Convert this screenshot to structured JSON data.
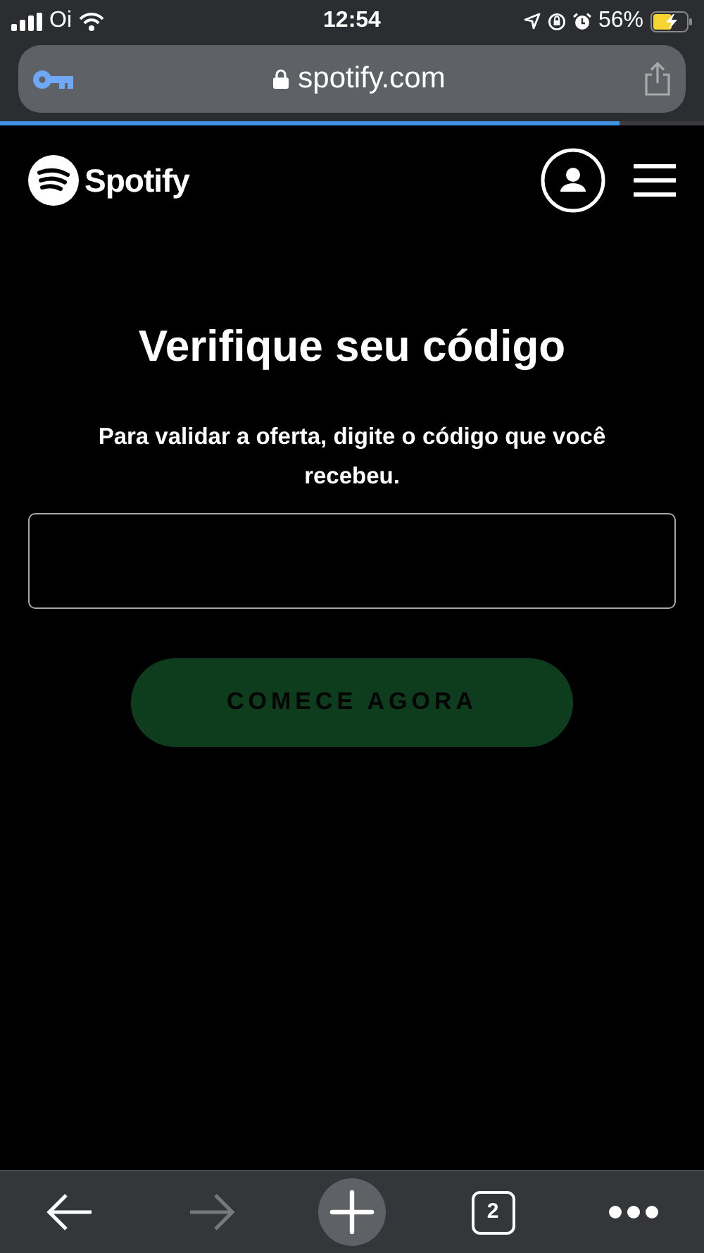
{
  "status_bar": {
    "carrier": "Oi",
    "time": "12:54",
    "battery": "56%"
  },
  "address_bar": {
    "url": "spotify.com",
    "load_progress": {
      "level": 0.88
    }
  },
  "header": {
    "logo_text": "Spotify"
  },
  "title": "Verifique seu código",
  "description": "Para validar a oferta, digite o código que você recebeu.",
  "submit_button": {
    "label": "COMECE AGORA",
    "disabled": true
  },
  "toolbar": {
    "buttons": [
      {
        "kind": "back",
        "disabled": false
      },
      {
        "kind": "forward",
        "disabled": true
      },
      {
        "kind": "new-tab",
        "disabled": false
      },
      {
        "kind": "tabs",
        "disabled": false,
        "count": "2"
      },
      {
        "kind": "more",
        "disabled": false
      }
    ]
  }
}
